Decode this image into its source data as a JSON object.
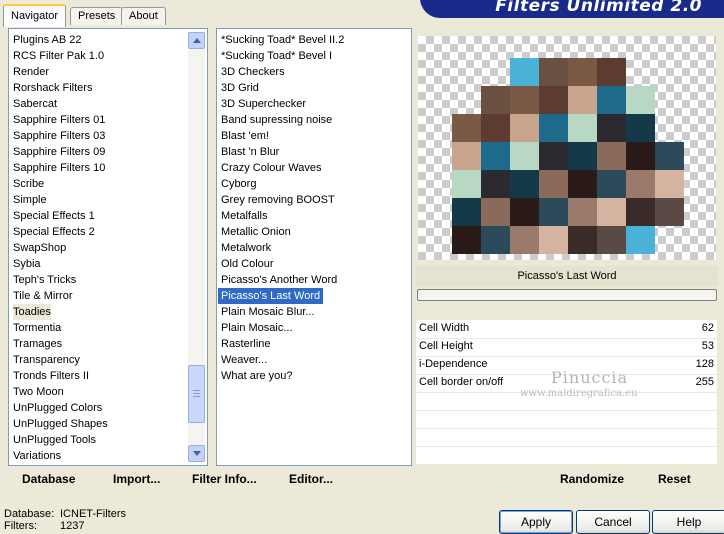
{
  "tabs": [
    "Navigator",
    "Presets",
    "About"
  ],
  "banner_title": "Filters Unlimited 2.0",
  "categories": [
    "Plugins AB 22",
    "RCS Filter Pak 1.0",
    "Render",
    "Rorshack Filters",
    "Sabercat",
    "Sapphire Filters 01",
    "Sapphire Filters 03",
    "Sapphire Filters 09",
    "Sapphire Filters 10",
    "Scribe",
    "Simple",
    "Special Effects 1",
    "Special Effects 2",
    "SwapShop",
    "Sybia",
    "Teph's Tricks",
    "Tile & Mirror",
    "Toadies",
    "Tormentia",
    "Tramages",
    "Transparency",
    "Tronds Filters II",
    "Two Moon",
    "UnPlugged Colors",
    "UnPlugged Shapes",
    "UnPlugged Tools",
    "Variations"
  ],
  "selected_category": "Toadies",
  "filters": [
    "*Sucking Toad*  Bevel II.2",
    "*Sucking Toad*  Bevel I",
    "3D Checkers",
    "3D Grid",
    "3D Superchecker",
    "Band supressing noise",
    "Blast 'em!",
    "Blast 'n Blur",
    "Crazy Colour Waves",
    "Cyborg",
    "Grey removing BOOST",
    "Metalfalls",
    "Metallic Onion",
    "Metalwork",
    "Old Colour",
    "Picasso's Another Word",
    "Picasso's Last Word",
    "Plain Mosaic Blur...",
    "Plain Mosaic...",
    "Rasterline",
    "Weaver...",
    "What are you?"
  ],
  "selected_filter": "Picasso's Last Word",
  "filter_name": "Picasso's Last Word",
  "params": [
    {
      "name": "Cell Width",
      "value": "62"
    },
    {
      "name": "Cell Height",
      "value": "53"
    },
    {
      "name": "i-Dependence",
      "value": "128"
    },
    {
      "name": "Cell border on/off",
      "value": "255"
    }
  ],
  "watermark": {
    "name": "Pinuccia",
    "site": "www.maidiregrafica.eu"
  },
  "links": {
    "database": "Database",
    "import": "Import...",
    "filter_info": "Filter Info...",
    "editor": "Editor..."
  },
  "actions": {
    "randomize": "Randomize",
    "reset": "Reset",
    "apply": "Apply",
    "cancel": "Cancel",
    "help": "Help"
  },
  "status": {
    "database_label": "Database:",
    "database_value": "ICNET-Filters",
    "filters_label": "Filters:",
    "filters_value": "1237"
  },
  "colors": {
    "accent": "#316ac5",
    "banner": "#1a2a8a",
    "face": "#ece9d8"
  },
  "icons": {
    "scroll_up": "chevron-up-icon",
    "scroll_down": "chevron-down-icon"
  }
}
